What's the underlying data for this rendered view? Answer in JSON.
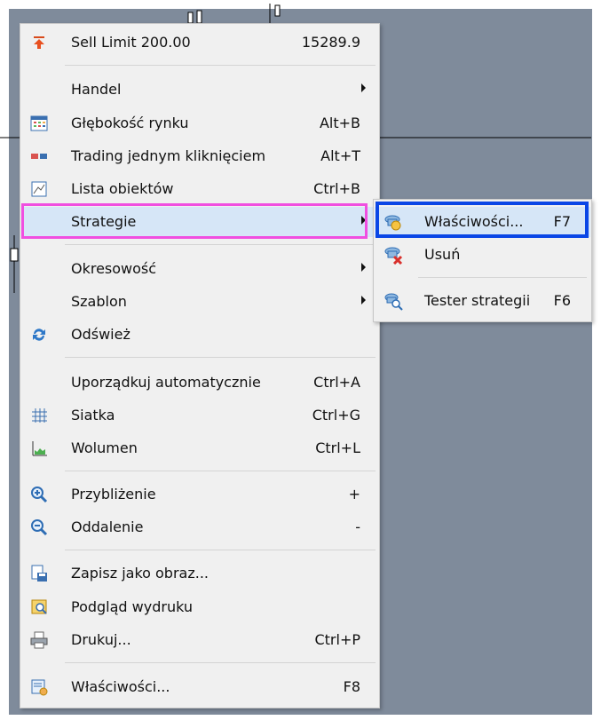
{
  "menu": {
    "items": [
      {
        "label": "Sell Limit 200.00",
        "shortcut": "15289.9",
        "icon": "sell-arrow-icon"
      },
      {
        "label": "Handel",
        "shortcut": "",
        "icon": ""
      },
      {
        "label": "Głębokość rynku",
        "shortcut": "Alt+B",
        "icon": "market-depth-icon"
      },
      {
        "label": "Trading jednym kliknięciem",
        "shortcut": "Alt+T",
        "icon": "one-click-trading-icon"
      },
      {
        "label": "Lista obiektów",
        "shortcut": "Ctrl+B",
        "icon": "object-list-icon"
      },
      {
        "label": "Strategie",
        "shortcut": "",
        "icon": ""
      },
      {
        "label": "Okresowość",
        "shortcut": "",
        "icon": ""
      },
      {
        "label": "Szablon",
        "shortcut": "",
        "icon": ""
      },
      {
        "label": "Odśwież",
        "shortcut": "",
        "icon": "refresh-icon"
      },
      {
        "label": "Uporządkuj automatycznie",
        "shortcut": "Ctrl+A",
        "icon": ""
      },
      {
        "label": "Siatka",
        "shortcut": "Ctrl+G",
        "icon": "grid-icon"
      },
      {
        "label": "Wolumen",
        "shortcut": "Ctrl+L",
        "icon": "volume-icon"
      },
      {
        "label": "Przybliżenie",
        "shortcut": "+",
        "icon": "zoom-in-icon"
      },
      {
        "label": "Oddalenie",
        "shortcut": "-",
        "icon": "zoom-out-icon"
      },
      {
        "label": "Zapisz jako obraz...",
        "shortcut": "",
        "icon": "save-image-icon"
      },
      {
        "label": "Podgląd wydruku",
        "shortcut": "",
        "icon": "print-preview-icon"
      },
      {
        "label": "Drukuj...",
        "shortcut": "Ctrl+P",
        "icon": "print-icon"
      },
      {
        "label": "Właściwości...",
        "shortcut": "F8",
        "icon": "properties-icon"
      }
    ]
  },
  "submenu": {
    "items": [
      {
        "label": "Właściwości...",
        "shortcut": "F7",
        "icon": "strategy-properties-icon"
      },
      {
        "label": "Usuń",
        "shortcut": "",
        "icon": "strategy-remove-icon"
      },
      {
        "label": "Tester strategii",
        "shortcut": "F6",
        "icon": "strategy-tester-icon"
      }
    ]
  },
  "colors": {
    "chart_background": "#7f8b9b",
    "menu_background": "#f0f0f0",
    "highlight": "#d6e6f7",
    "pink_annotation": "#f04fe0",
    "blue_annotation": "#0a46e6"
  }
}
